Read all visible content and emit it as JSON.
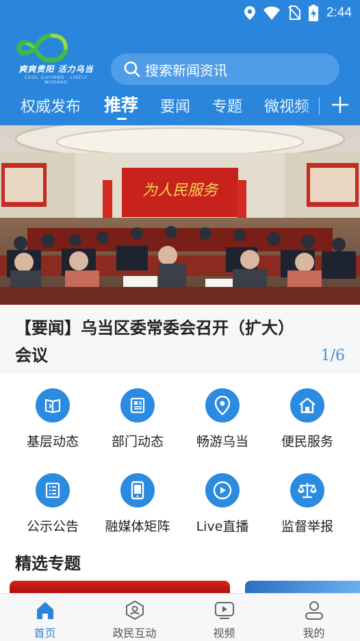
{
  "status_bar": {
    "time": "2:44"
  },
  "logo": {
    "text": "爽爽贵阳 活力乌当",
    "sub": "COOL GUIYANG · LIVELY WUDANG"
  },
  "search": {
    "placeholder": "搜索新闻资讯"
  },
  "tabs": [
    {
      "label": "权威发布",
      "active": false
    },
    {
      "label": "推荐",
      "active": true
    },
    {
      "label": "要闻",
      "active": false
    },
    {
      "label": "专题",
      "active": false
    },
    {
      "label": "微视频",
      "active": false
    }
  ],
  "banner": {
    "backdrop_text": "为人民服务",
    "headline": "【要闻】乌当区委常委会召开（扩大）会议",
    "pager": "1/6"
  },
  "grid": [
    {
      "label": "基层动态",
      "icon": "book-icon"
    },
    {
      "label": "部门动态",
      "icon": "newspaper-icon"
    },
    {
      "label": "畅游乌当",
      "icon": "location-pin-icon"
    },
    {
      "label": "便民服务",
      "icon": "home-icon"
    },
    {
      "label": "公示公告",
      "icon": "list-document-icon"
    },
    {
      "label": "融媒体矩阵",
      "icon": "tablet-icon"
    },
    {
      "label": "Live直播",
      "icon": "play-circle-icon"
    },
    {
      "label": "监督举报",
      "icon": "scales-icon"
    }
  ],
  "section": {
    "title": "精选专题"
  },
  "bottom_nav": [
    {
      "label": "首页",
      "icon": "home-icon",
      "active": true
    },
    {
      "label": "政民互动",
      "icon": "hexagon-user-icon",
      "active": false
    },
    {
      "label": "视频",
      "icon": "video-play-icon",
      "active": false
    },
    {
      "label": "我的",
      "icon": "person-icon",
      "active": false
    }
  ],
  "colors": {
    "primary": "#2a86dc",
    "icon_circle": "#2a8be0",
    "pager": "#3b8fdc"
  }
}
